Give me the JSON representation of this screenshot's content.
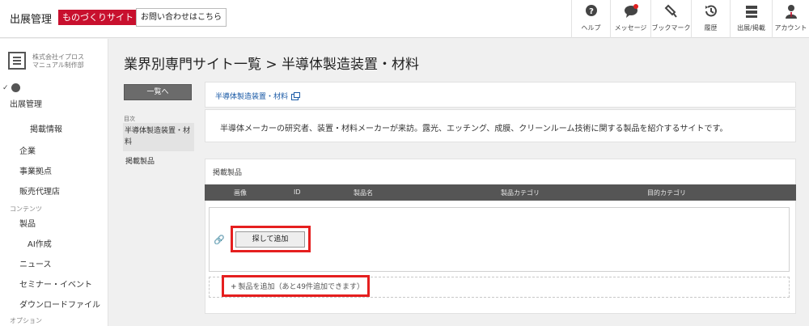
{
  "header": {
    "brand": "出展管理",
    "badge": "ものづくりサイト",
    "contact_button": "お問い合わせはこちら",
    "nav": [
      {
        "label": "ヘルプ",
        "icon": "help-icon"
      },
      {
        "label": "メッセージ",
        "icon": "message-icon"
      },
      {
        "label": "ブックマーク",
        "icon": "bookmark-icon"
      },
      {
        "label": "履歴",
        "icon": "history-icon"
      },
      {
        "label": "出展/掲載",
        "icon": "listing-icon"
      },
      {
        "label": "アカウント",
        "icon": "account-icon"
      }
    ],
    "colors": {
      "badge": "#c8102e",
      "notification": "#e02020"
    }
  },
  "sidebar": {
    "company_line1": "株式会社イプロス",
    "company_line2": "マニュアル制作部",
    "items": {
      "exhibit_mgmt": "出展管理",
      "listing_info": "掲載情報",
      "company": "企業",
      "business_sites": "事業拠点",
      "agents": "販売代理店",
      "products": "製品",
      "ai_create": "AI作成",
      "news": "ニュース",
      "seminar": "セミナー・イベント",
      "download": "ダウンロードファイル"
    },
    "sections": {
      "content": "コンテンツ",
      "option": "オプション"
    }
  },
  "main": {
    "title": "業界別専門サイト一覧 > 半導体製造装置・材料",
    "back_button": "一覧へ",
    "toc": {
      "label": "目次",
      "active": "半導体製造装置・材料",
      "item": "掲載製品"
    },
    "site_link": "半導体製造装置・材料",
    "description": "半導体メーカーの研究者、装置・材料メーカーが来訪。露光、エッチング、成膜、クリーンルーム技術に関する製品を紹介するサイトです。",
    "products_section": {
      "title": "掲載製品",
      "columns": [
        "画像",
        "ID",
        "製品名",
        "製品カテゴリ",
        "目的カテゴリ"
      ],
      "search_add_button": "探して追加",
      "add_product_button": "製品を追加（あと49件追加できます）"
    },
    "highlight_color": "#e51f1f"
  }
}
